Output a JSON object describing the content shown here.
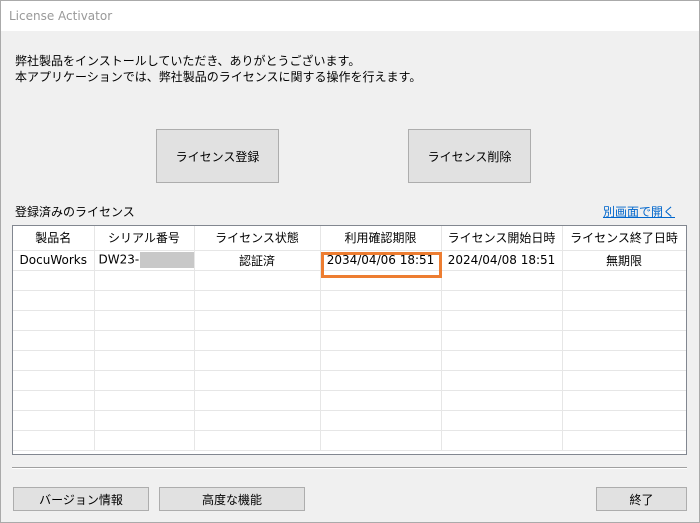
{
  "window": {
    "title": "License Activator"
  },
  "intro": {
    "line1": "弊社製品をインストールしていただき、ありがとうございます。",
    "line2": "本アプリケーションでは、弊社製品のライセンスに関する操作を行えます。"
  },
  "actions": {
    "register_label": "ライセンス登録",
    "delete_label": "ライセンス削除"
  },
  "licenses": {
    "section_label": "登録済みのライセンス",
    "open_window_link": "別画面で開く",
    "columns": [
      "製品名",
      "シリアル番号",
      "ライセンス状態",
      "利用確認期限",
      "ライセンス開始日時",
      "ライセンス終了日時"
    ],
    "rows": [
      {
        "product": "DocuWorks",
        "serial": "DW23-",
        "status": "認証済",
        "confirm_deadline": "2034/04/06 18:51",
        "start": "2024/04/08 18:51",
        "end": "無期限"
      }
    ]
  },
  "footer": {
    "version_label": "バージョン情報",
    "advanced_label": "高度な機能",
    "exit_label": "終了"
  },
  "colors": {
    "highlight": "#ed7d31",
    "link": "#0066cc"
  }
}
